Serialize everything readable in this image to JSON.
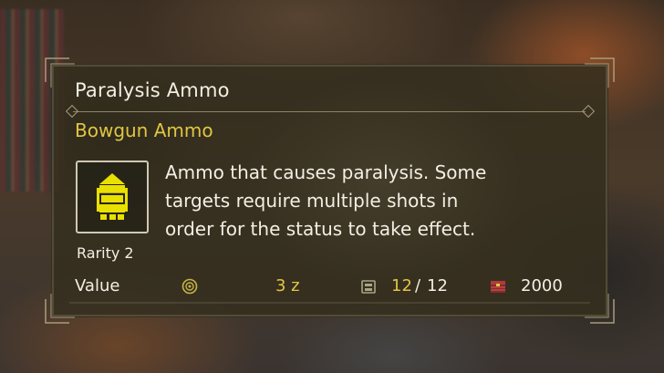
{
  "item": {
    "name": "Paralysis Ammo",
    "category": "Bowgun Ammo",
    "rarity_label": "Rarity 2",
    "description_lines": [
      "Ammo that causes paralysis. Some",
      "targets require multiple shots in",
      "order for the status to take effect."
    ],
    "icon": "paralysis-ammo-icon",
    "icon_color": "#e9e000"
  },
  "stats": {
    "value_label": "Value",
    "money_icon": "zenny-coin-icon",
    "money_text": "3 z",
    "carry_icon": "pouch-icon",
    "carry_current": "12",
    "carry_separator": "/",
    "carry_max": "12",
    "box_icon": "item-box-icon",
    "box_count": "2000"
  },
  "colors": {
    "text": "#f3efe4",
    "accent_yellow": "#e0c642",
    "panel_bg": "#342e1e",
    "frame": "#a79c7a"
  }
}
